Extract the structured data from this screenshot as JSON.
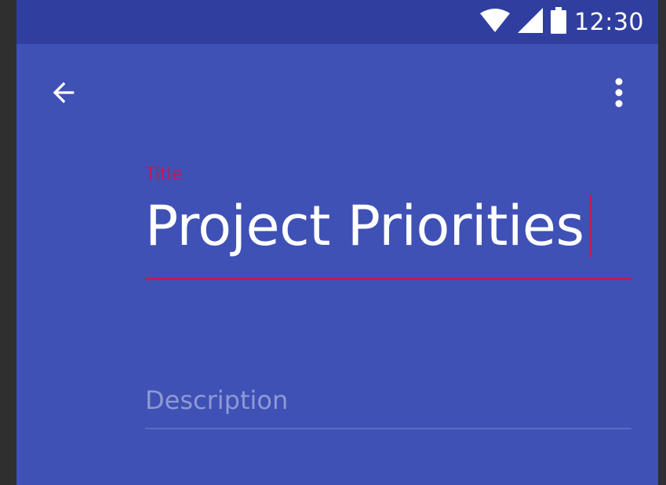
{
  "status_bar": {
    "time": "12:30",
    "icons": [
      "wifi-icon",
      "cell-signal-icon",
      "battery-icon"
    ]
  },
  "toolbar": {
    "back_icon": "arrow-back-icon",
    "overflow_icon": "more-vert-icon"
  },
  "form": {
    "title": {
      "label": "Title",
      "value": "Project Priorities"
    },
    "description": {
      "placeholder": "Description",
      "value": ""
    }
  },
  "colors": {
    "primary": "#3f51b5",
    "primary_dark": "#303f9f",
    "accent": "#c2185b",
    "hint": "#8e99d4"
  }
}
